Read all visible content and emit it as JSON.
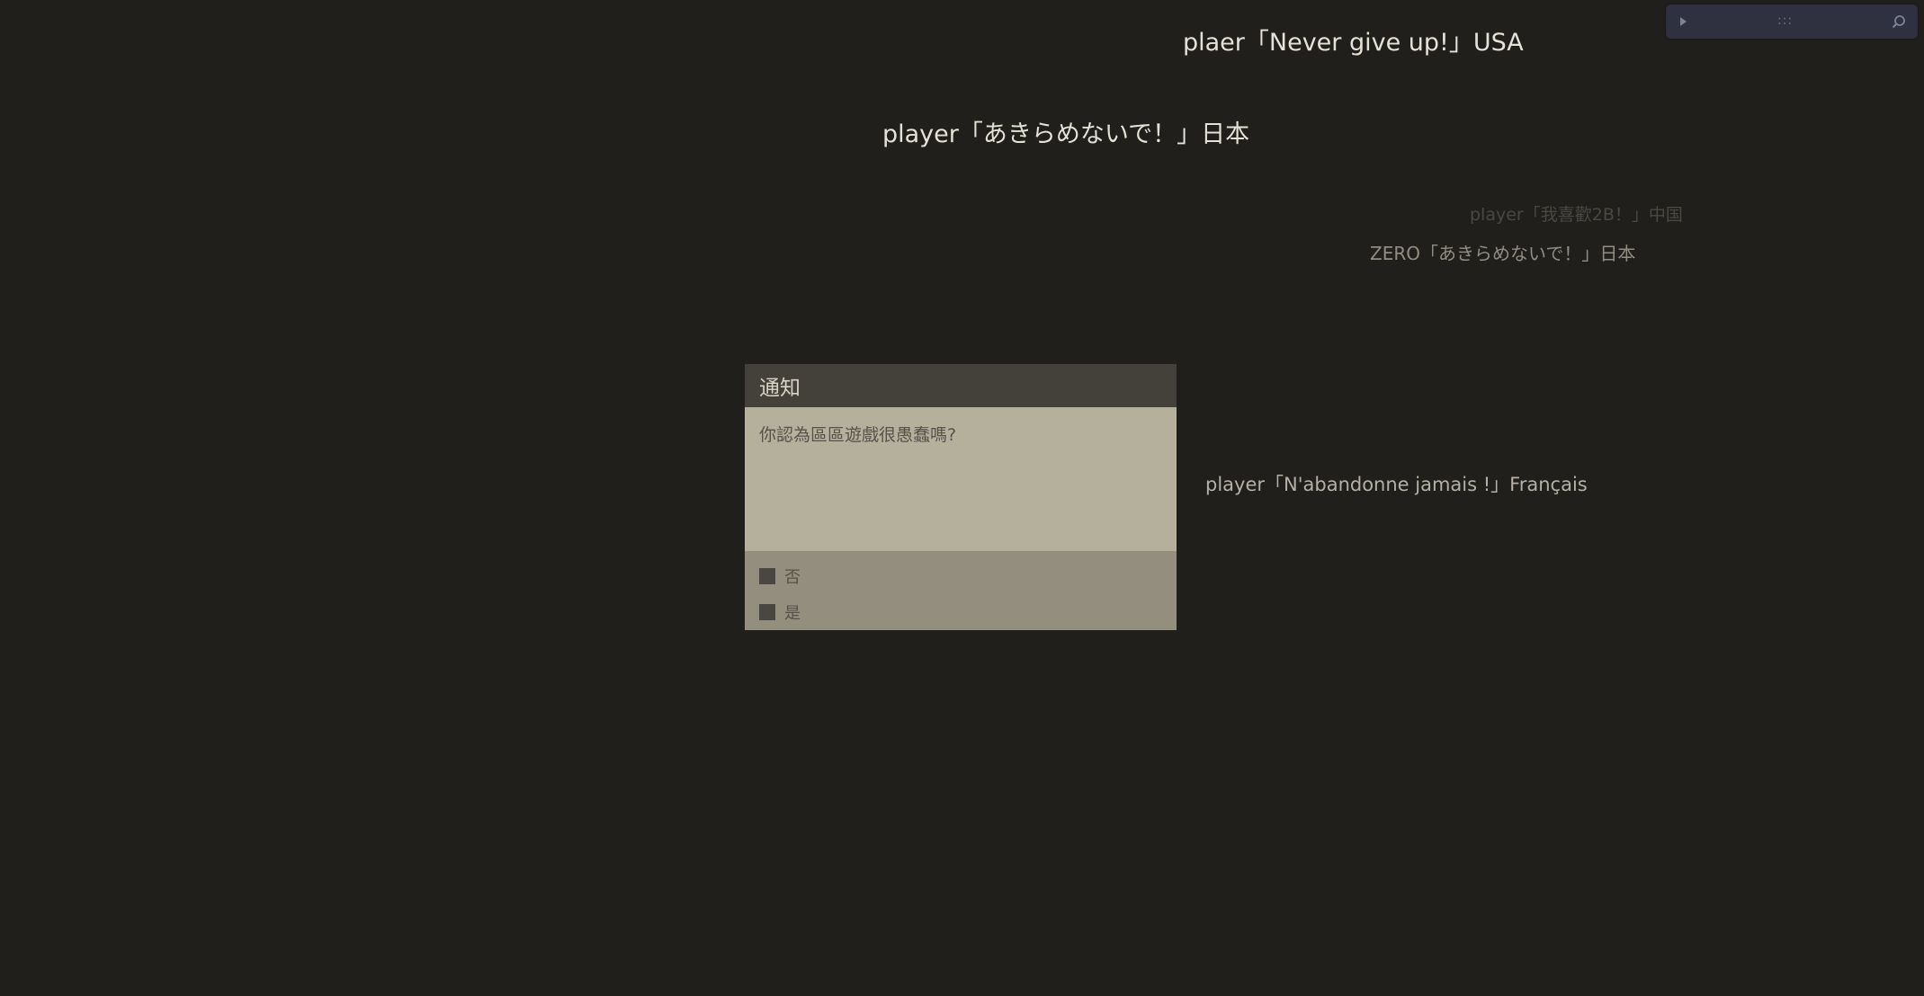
{
  "messages": {
    "usa": "plaer「Never give up!」USA",
    "japan_main": "player「あきらめないで！」日本",
    "china": "player「我喜歡2B！」中国",
    "japan_zero": "ZERO「あきらめないで！」日本",
    "france": "player「N'abandonne jamais !」Français"
  },
  "dialog": {
    "title": "通知",
    "question": "你認為區區遊戲很愚蠢嗎?",
    "options": [
      "否",
      "是"
    ]
  },
  "toolbar": {
    "icons": [
      "play-icon",
      "drag-handle-icon",
      "search-icon"
    ],
    "grip": ":::"
  },
  "colors": {
    "background": "#201f1c",
    "dialog_header": "#44413a",
    "dialog_body": "#b5b09c",
    "dialog_options": "#938e7e",
    "toolbar": "#2f3140"
  }
}
